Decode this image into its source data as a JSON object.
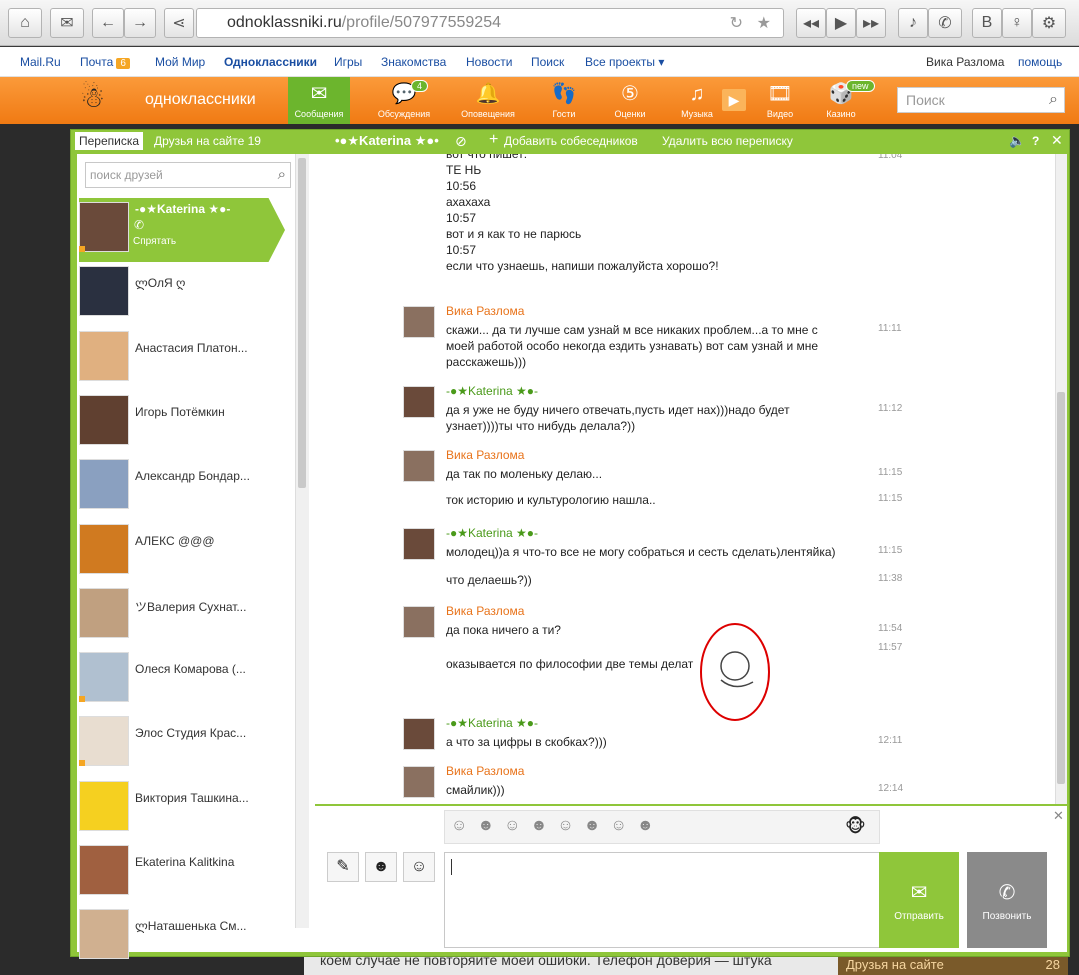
{
  "browser": {
    "url_host": "odnoklassniki.ru",
    "url_path": "/profile/507977559254"
  },
  "mailnav": {
    "items": [
      "Mail.Ru",
      "Почта",
      "Мой Мир",
      "Одноклассники",
      "Игры",
      "Знакомства",
      "Новости",
      "Поиск",
      "Все проекты ▾"
    ],
    "mail_count": "6",
    "user": "Вика Разлома",
    "help": "помощь",
    "logout": "вых"
  },
  "header": {
    "logo": "одноклассники",
    "nav": [
      {
        "label": "Сообщения"
      },
      {
        "label": "Обсуждения",
        "badge": "4"
      },
      {
        "label": "Оповещения"
      },
      {
        "label": "Гости"
      },
      {
        "label": "Оценки"
      },
      {
        "label": "Музыка"
      },
      {
        "label": "Видео"
      },
      {
        "label": "Казино",
        "badge": "new"
      }
    ],
    "search_placeholder": "Поиск"
  },
  "chat": {
    "tabs": {
      "conversations": "Переписка",
      "friends_online": "Друзья на сайте 19",
      "active_name": "•●★Katerina ★●•",
      "add": "Добавить собеседников",
      "delete_all": "Удалить всю переписку"
    },
    "friend_search_placeholder": "поиск друзей",
    "friends": [
      {
        "name": "-●★Katerina ★●-",
        "sub": "Спрятать"
      },
      {
        "name": "ლОлЯ ღ"
      },
      {
        "name": "Анастасия Платон..."
      },
      {
        "name": "Игорь Потёмкин"
      },
      {
        "name": "Александр Бондар..."
      },
      {
        "name": "АЛЕКС @@@"
      },
      {
        "name": "ツВалерия Сухнат..."
      },
      {
        "name": "Олеся Комарова (..."
      },
      {
        "name": "Элос Студия Крас..."
      },
      {
        "name": "Виктория Ташкина..."
      },
      {
        "name": "Ekaterina Kalitkina"
      },
      {
        "name": "ლНаташенька См..."
      }
    ],
    "messages": [
      {
        "author": "",
        "text": "вот что пишет:\nТЕ НЬ\n10:56\nахахаха\n10:57\nвот и я как то не парюсь\n10:57\nесли что узнаешь, напиши пожалуйста хорошо?!",
        "time": "11:04"
      },
      {
        "author": "Вика Разлома",
        "text": "скажи... да ти лучше сам узнай м все никаких проблем...а то мне с моей работой особо некогда ездить узнавать) вот сам узнай и мне расскажешь)))",
        "time": "11:11"
      },
      {
        "author": "-●★Katerina ★●-",
        "text": "да я уже не буду ничего отвечать,пусть идет нах)))надо будет узнает))))ты что нибудь делала?))",
        "time": "11:12"
      },
      {
        "author": "Вика Разлома",
        "text": "да так по моленьку делаю...",
        "time": "11:15"
      },
      {
        "author": "",
        "text": "ток историю и культурологию нашла..",
        "time": "11:15"
      },
      {
        "author": "-●★Katerina ★●-",
        "text": "молодец))а я что-то все не могу собраться и сесть сделать)лентяйка)",
        "time": "11:15"
      },
      {
        "author": "",
        "text": "что делаешь?))",
        "time": "11:38"
      },
      {
        "author": "Вика Разлома",
        "text": "да пока ничего а ти?",
        "time": "11:54"
      },
      {
        "author": "",
        "text": "оказывается по философии две темы делат",
        "time": "11:57"
      },
      {
        "author": "-●★Katerina ★●-",
        "text": "а что за цифры в скобках?)))",
        "time": "12:11"
      },
      {
        "author": "Вика Разлома",
        "text": "смайлик)))",
        "time": "12:14"
      }
    ],
    "send": "Отправить",
    "call": "Позвонить"
  },
  "page_bottom": {
    "text": "коем случае не повторяйте моей ошибки. Телефон доверия — штука",
    "right_label": "Друзья на сайте",
    "right_count": "28"
  },
  "colors": {
    "ok_orange": "#f58a21",
    "ok_green": "#8fc63a",
    "me_name": "#e8731a",
    "her_name": "#4a9a1a"
  }
}
